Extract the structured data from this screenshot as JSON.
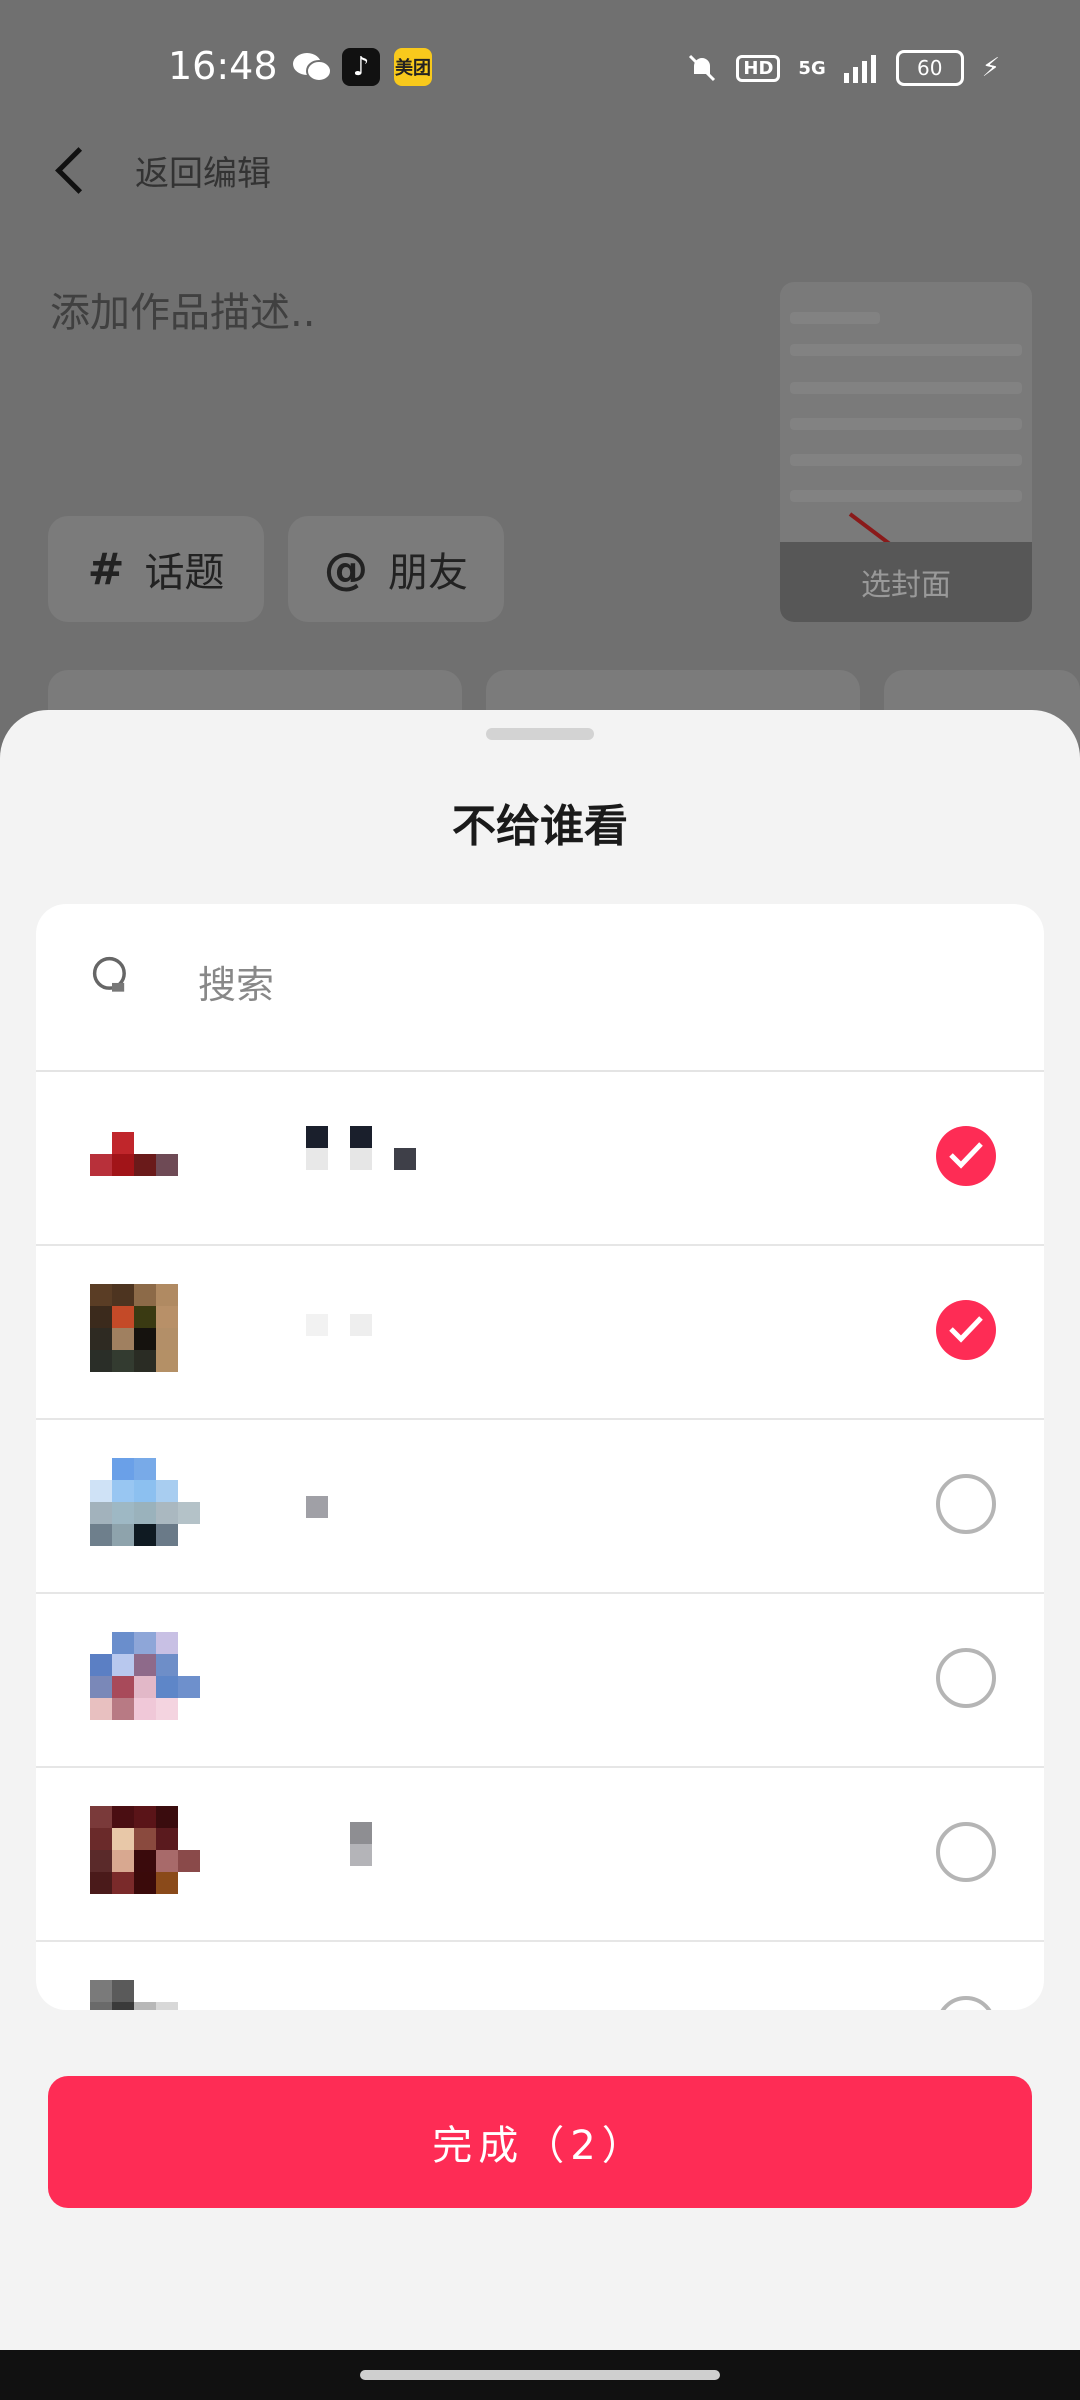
{
  "status_bar": {
    "time": "16:48",
    "left_icons": [
      "wechat-icon",
      "douyin-icon",
      "meituan-icon"
    ],
    "meituan_label": "美团",
    "hd_label": "HD",
    "network_label": "5G",
    "battery_level": "60"
  },
  "background_page": {
    "back_label": "返回编辑",
    "description_placeholder": "添加作品描述..",
    "topic_chip": {
      "symbol": "#",
      "label": "话题"
    },
    "friend_chip": {
      "symbol": "@",
      "label": "朋友"
    },
    "cover_label": "选封面"
  },
  "sheet": {
    "title": "不给谁看",
    "search_placeholder": "搜索",
    "contacts": [
      {
        "selected": true
      },
      {
        "selected": true
      },
      {
        "selected": false
      },
      {
        "selected": false
      },
      {
        "selected": false
      },
      {
        "selected": false
      }
    ],
    "done_label": "完成（2）"
  },
  "colors": {
    "accent": "#fe2c55",
    "sheet_background": "#f3f3f3",
    "dim_overlay": "#6f6f6f"
  }
}
